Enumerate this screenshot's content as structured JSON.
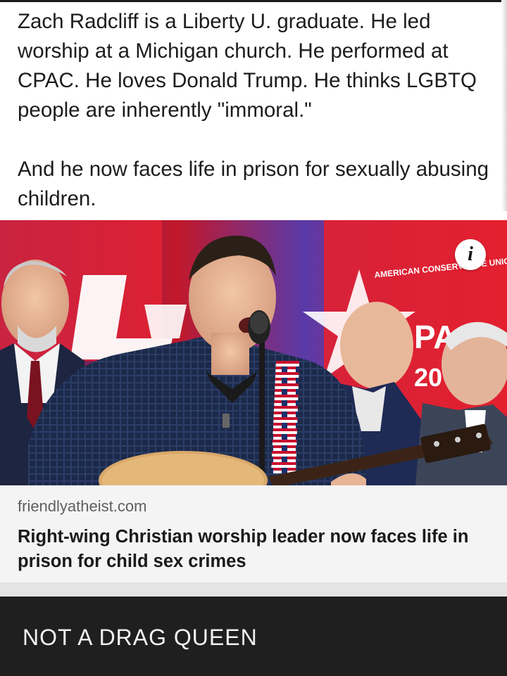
{
  "post": {
    "paragraph_1": "Zach Radcliff is a Liberty U. graduate. He led worship at a Michigan church. He performed at CPAC. He loves Donald Trump. He thinks LGBTQ people are inherently \"immoral.\"",
    "paragraph_2": "And he now faces life in prison for sexually abusing children."
  },
  "link_preview": {
    "image_alt": "Man singing into a microphone and playing acoustic guitar on a CPAC stage with other men behind him",
    "stage_sign_text": "AMERICAN CONSERVATIVE UNION",
    "stage_sign_partial": "PA",
    "stage_sign_year": "20",
    "info_icon_glyph": "i",
    "domain": "friendlyatheist.com",
    "title": "Right-wing Christian worship leader now faces life in prison for child sex crimes"
  },
  "caption": {
    "text": "NOT A DRAG QUEEN"
  },
  "colors": {
    "caption_background": "#1f1f1f",
    "card_meta_background": "#f4f4f4",
    "stage_red": "#e0202c",
    "stage_blue": "#2a1f7a"
  }
}
